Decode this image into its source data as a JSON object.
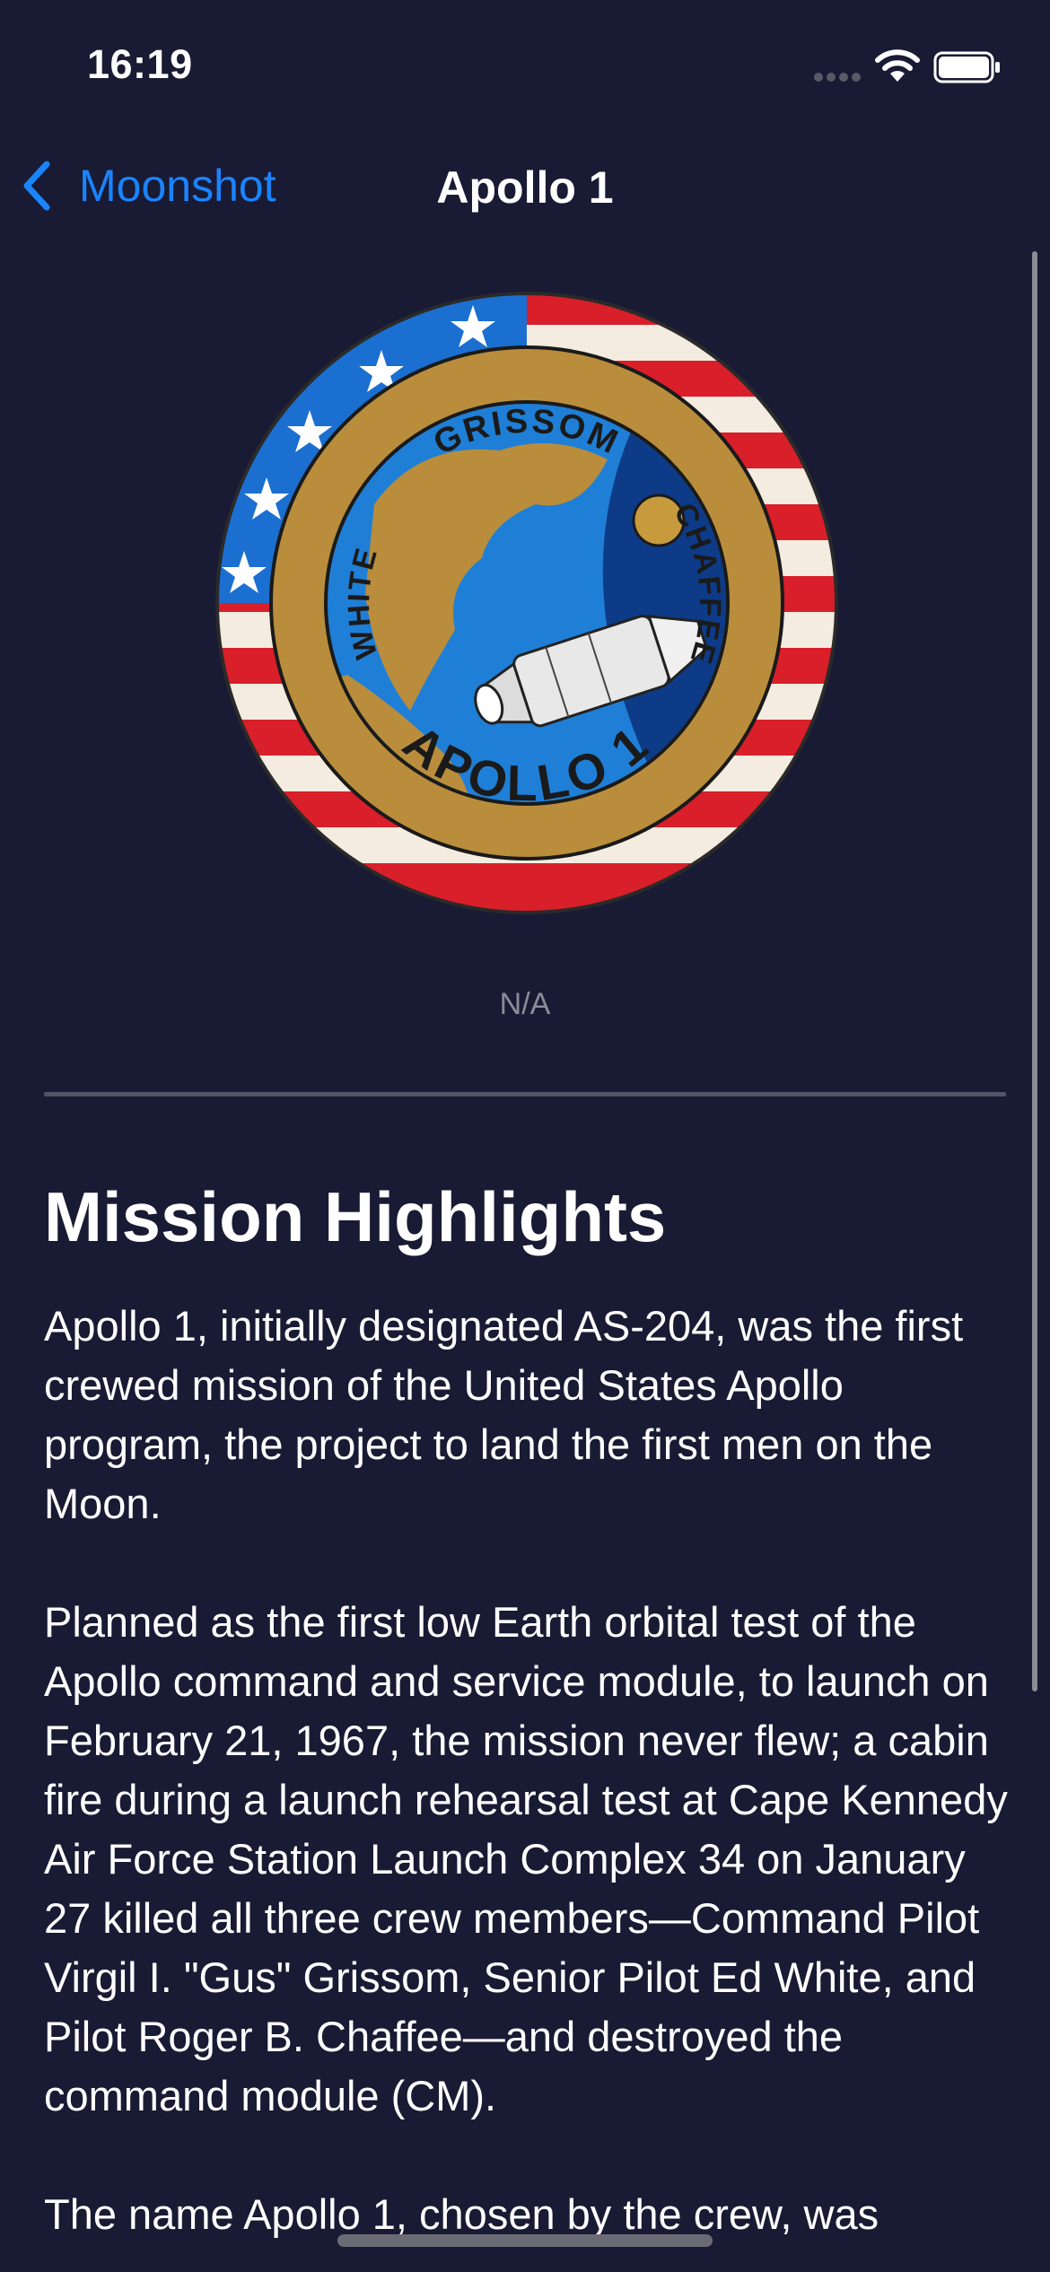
{
  "status_bar": {
    "time": "16:19",
    "icons": [
      "cellular-signal-icon",
      "wifi-icon",
      "battery-icon"
    ]
  },
  "nav": {
    "back_label": "Moonshot",
    "back_icon": "chevron-left-icon",
    "title": "Apollo 1"
  },
  "badge": {
    "image_name": "apollo-1-mission-patch",
    "patch_text": {
      "top": "GRISSOM",
      "left": "WHITE",
      "right": "CHAFFEE",
      "bottom": "APOLLO 1"
    }
  },
  "mission": {
    "launch_date": "N/A",
    "highlights_title": "Mission Highlights",
    "description": "Apollo 1, initially designated AS-204, was the first crewed mission of the United States Apollo program, the project to land the first men on the Moon.\n\nPlanned as the first low Earth orbital test of the Apollo command and service module, to launch on February 21, 1967, the mission never flew; a cabin fire during a launch rehearsal test at Cape Kennedy Air Force Station Launch Complex 34 on January 27 killed all three crew members—Command Pilot Virgil I. \"Gus\" Grissom, Senior Pilot Ed White, and Pilot Roger B. Chaffee—and destroyed the command module (CM).\n\nThe name Apollo 1, chosen by the crew, was"
  },
  "colors": {
    "background": "#191A33",
    "accent": "#1A84FF",
    "secondary_text": "#8C8C99"
  }
}
